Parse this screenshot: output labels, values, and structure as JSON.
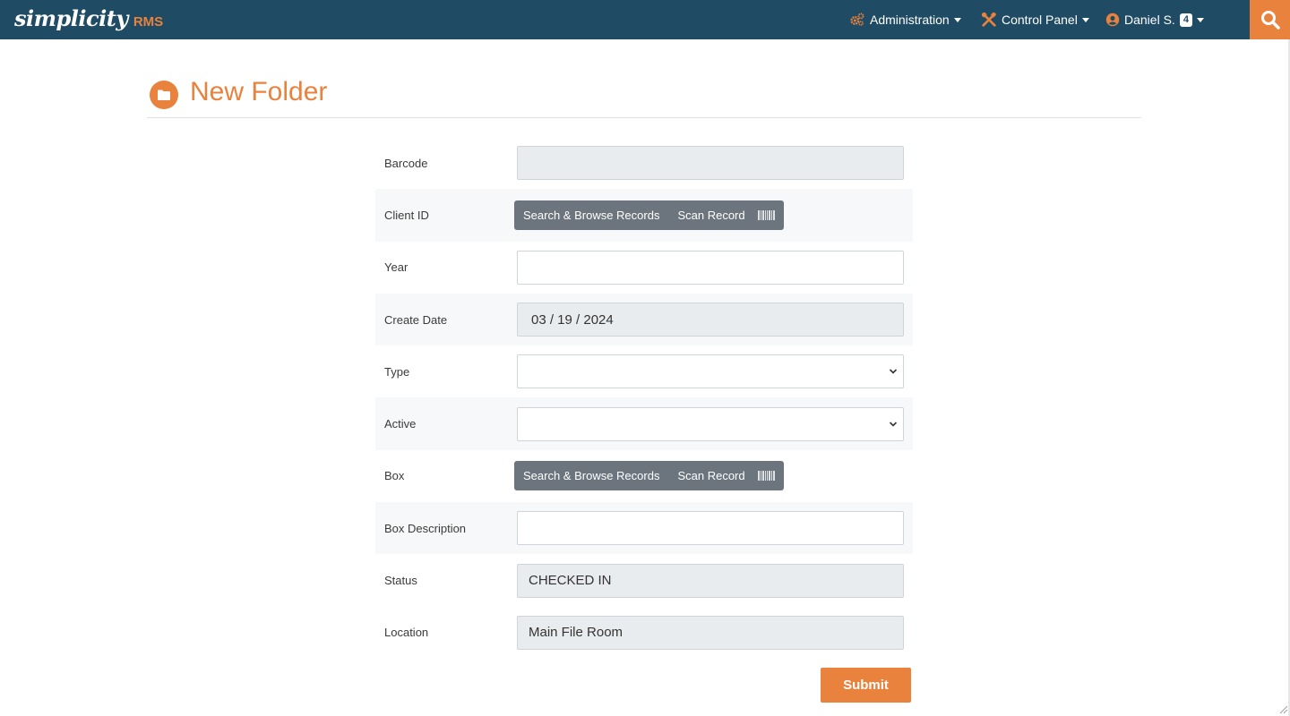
{
  "brand": {
    "name": "simplicity",
    "suffix": "RMS"
  },
  "nav": {
    "administration": "Administration",
    "control_panel": "Control Panel",
    "user": "Daniel S.",
    "user_badge": "4"
  },
  "page": {
    "title": "New Folder"
  },
  "form": {
    "barcode": {
      "label": "Barcode",
      "value": ""
    },
    "client_id": {
      "label": "Client ID",
      "search_label": "Search & Browse Records",
      "scan_label": "Scan Record"
    },
    "year": {
      "label": "Year",
      "value": ""
    },
    "create_date": {
      "label": "Create Date",
      "value": "03 / 19 / 2024"
    },
    "type": {
      "label": "Type",
      "value": ""
    },
    "active": {
      "label": "Active",
      "value": ""
    },
    "box": {
      "label": "Box",
      "search_label": "Search & Browse Records",
      "scan_label": "Scan Record"
    },
    "box_description": {
      "label": "Box Description",
      "value": ""
    },
    "status": {
      "label": "Status",
      "value": "CHECKED IN"
    },
    "location": {
      "label": "Location",
      "value": "Main File Room"
    }
  },
  "actions": {
    "submit": "Submit"
  },
  "colors": {
    "navbar": "#1f4b64",
    "accent": "#e8823d",
    "button_gray": "#6c757d"
  },
  "icons": {
    "administration": "cogs-icon",
    "control_panel": "tools-icon",
    "user": "user-circle-icon",
    "search": "search-icon",
    "page": "folder-icon",
    "scan": "barcode-icon",
    "select": "chevron-down-icon"
  }
}
